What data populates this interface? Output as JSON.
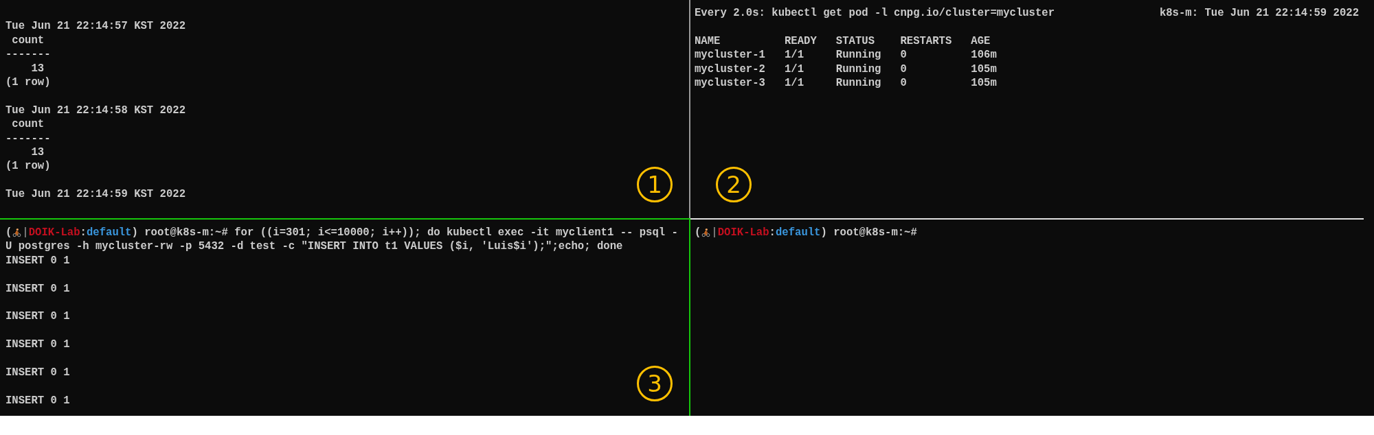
{
  "top_left_pane": {
    "kind": "output",
    "active": false,
    "marker": "1",
    "blocks": [
      [
        "Tue Jun 21 22:14:57 KST 2022",
        " count",
        "-------",
        "    13",
        "(1 row)"
      ],
      [
        "Tue Jun 21 22:14:58 KST 2022",
        " count",
        "-------",
        "    13",
        "(1 row)"
      ],
      [
        "Tue Jun 21 22:14:59 KST 2022"
      ]
    ]
  },
  "top_right_pane": {
    "kind": "watch",
    "active": false,
    "marker": "2",
    "header": "Every 2.0s: kubectl get pod -l cnpg.io/cluster=mycluster",
    "header_right": "k8s-m: Tue Jun 21 22:14:59 2022",
    "table": {
      "columns": [
        "NAME",
        "READY",
        "STATUS",
        "RESTARTS",
        "AGE"
      ],
      "rows": [
        [
          "mycluster-1",
          "1/1",
          "Running",
          "0",
          "106m"
        ],
        [
          "mycluster-2",
          "1/1",
          "Running",
          "0",
          "105m"
        ],
        [
          "mycluster-3",
          "1/1",
          "Running",
          "0",
          "105m"
        ]
      ]
    }
  },
  "bottom_left_pane": {
    "kind": "shell",
    "active": true,
    "marker": "3",
    "prompt": {
      "open": "(",
      "sep": "|",
      "context": "DOIK-Lab",
      "colon": ":",
      "namespace": "default",
      "rest": ") root@k8s-m:~#"
    },
    "command": [
      " for ((i=301; i<=10000; i++)); do kubectl exec -it myclient1 -- psql -",
      "U postgres -h mycluster-rw -p 5432 -d test -c \"INSERT INTO t1 VALUES ($i, 'Luis$i');\";echo; done"
    ],
    "blocks": [
      [
        "INSERT 0 1"
      ],
      [
        "INSERT 0 1"
      ],
      [
        "INSERT 0 1"
      ],
      [
        "INSERT 0 1"
      ],
      [
        "INSERT 0 1"
      ],
      [
        "INSERT 0 1"
      ]
    ]
  },
  "bottom_right_pane": {
    "kind": "shell",
    "active": false,
    "prompt": {
      "open": "(",
      "sep": "|",
      "context": "DOIK-Lab",
      "colon": ":",
      "namespace": "default",
      "rest": ") root@k8s-m:~#"
    }
  }
}
